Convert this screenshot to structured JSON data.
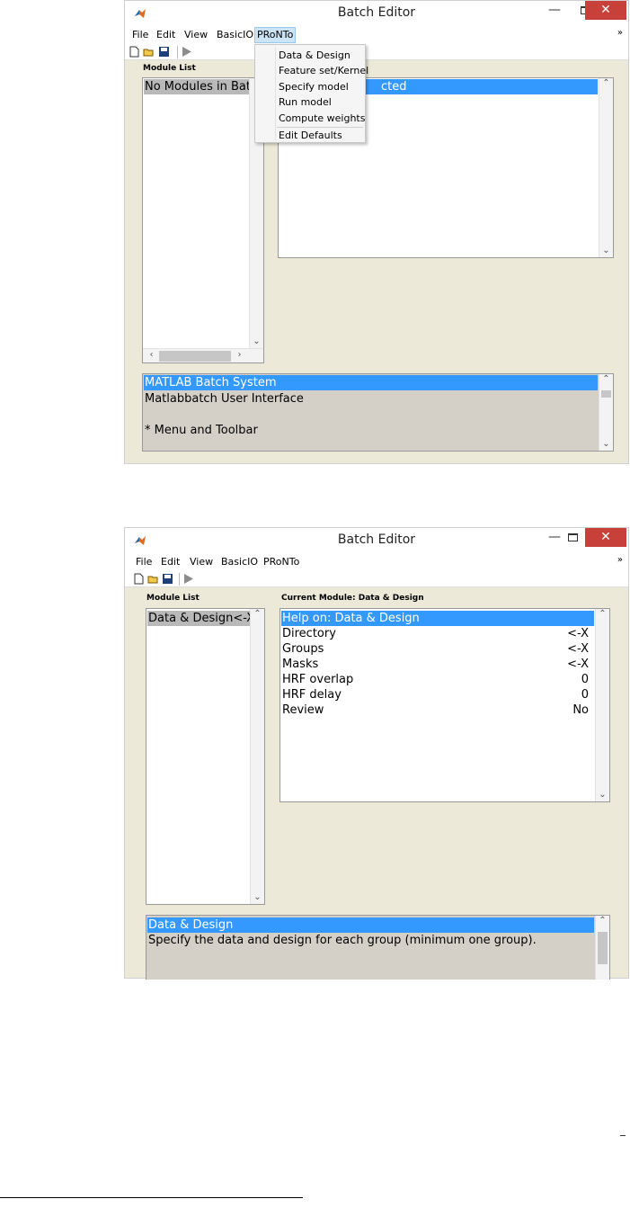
{
  "window1": {
    "title": "Batch Editor",
    "menus": [
      "File",
      "Edit",
      "View",
      "BasicIO",
      "PRoNTo"
    ],
    "active_menu": "PRoNTo",
    "module_list_label": "Module List",
    "module_list_text": "No Modules in Batc",
    "current_module_text": "cted",
    "dropdown_items": [
      "Data & Design",
      "Feature set/Kernel",
      "Specify model",
      "Run model",
      "Compute weights",
      "Edit Defaults"
    ],
    "help_lines": [
      "MATLAB Batch System",
      "Matlabbatch User Interface",
      "",
      "* Menu and Toolbar"
    ]
  },
  "window2": {
    "title": "Batch Editor",
    "menus": [
      "File",
      "Edit",
      "View",
      "BasicIO",
      "PRoNTo"
    ],
    "module_list_label": "Module List",
    "current_module_label": "Current Module: Data & Design",
    "module_list_item": "Data & Design<-X",
    "current_module_rows": [
      {
        "label": "Help on: Data & Design",
        "value": ""
      },
      {
        "label": "Directory",
        "value": "<-X"
      },
      {
        "label": "Groups",
        "value": "<-X"
      },
      {
        "label": "Masks",
        "value": "<-X"
      },
      {
        "label": "HRF overlap",
        "value": "0"
      },
      {
        "label": "HRF delay",
        "value": "0"
      },
      {
        "label": "Review",
        "value": "No"
      }
    ],
    "help_lines": [
      "Data & Design",
      "Specify the data and design for each group (minimum one group)."
    ]
  },
  "colors": {
    "selection_blue": "#3399ff",
    "selection_gray": "#b9b9b9",
    "window_bg": "#ece9d8",
    "close_red": "#c7403a"
  },
  "icons": {
    "app": "matlab-icon",
    "new": "new-file-icon",
    "open": "open-folder-icon",
    "save": "save-icon",
    "run": "run-icon"
  }
}
